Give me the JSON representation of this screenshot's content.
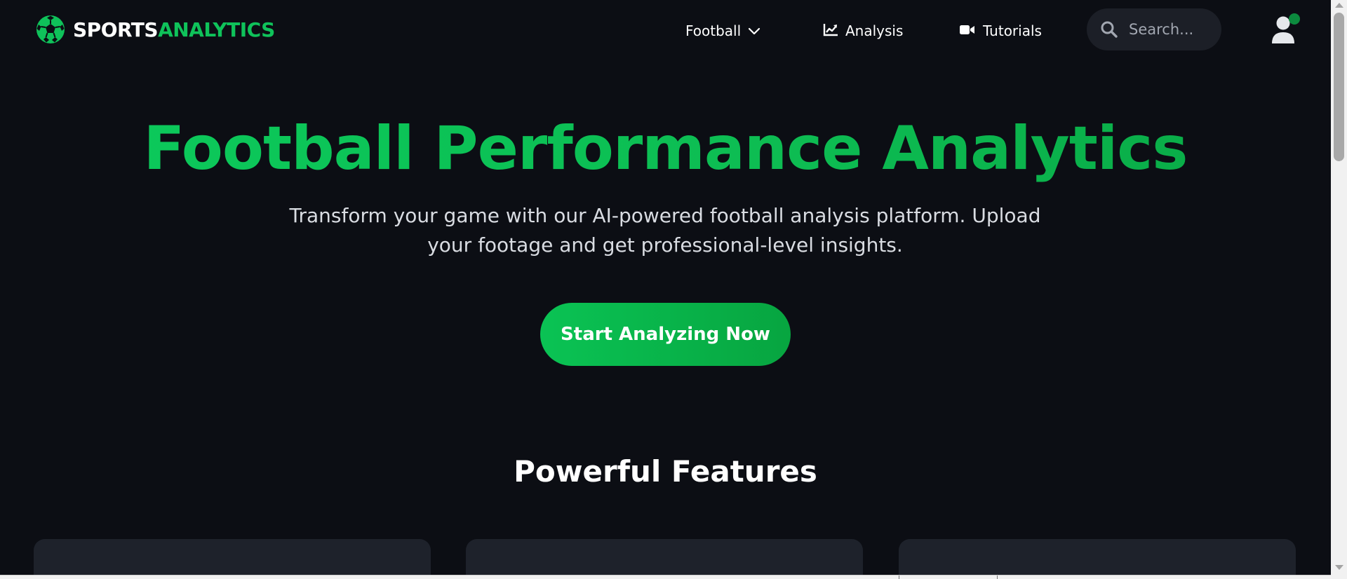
{
  "brand": {
    "name_part1": "SPORTS",
    "name_part2": "ANALYTICS",
    "icon": "soccer-ball-icon",
    "accent_color": "#0fc25a"
  },
  "nav": {
    "items": [
      {
        "label": "Football",
        "icon": "chevron-down-icon"
      },
      {
        "label": "Analysis",
        "icon": "chart-line-icon"
      },
      {
        "label": "Tutorials",
        "icon": "video-camera-icon"
      }
    ],
    "search": {
      "placeholder": "Search...",
      "value": "",
      "icon": "search-icon"
    },
    "user": {
      "icon": "user-icon",
      "status": "online",
      "status_color": "#0c8a3e"
    }
  },
  "hero": {
    "title": "Football Performance Analytics",
    "subtitle": "Transform your game with our AI-powered football analysis platform. Upload your footage and get professional-level insights.",
    "cta_label": "Start Analyzing Now"
  },
  "features": {
    "title": "Powerful Features",
    "cards": [
      {},
      {},
      {}
    ]
  },
  "colors": {
    "background": "#0c0e14",
    "card": "#1e222b",
    "search_bg": "#1c1f27",
    "subtitle_text": "#d9dce2",
    "placeholder_text": "#a2a7b1"
  }
}
